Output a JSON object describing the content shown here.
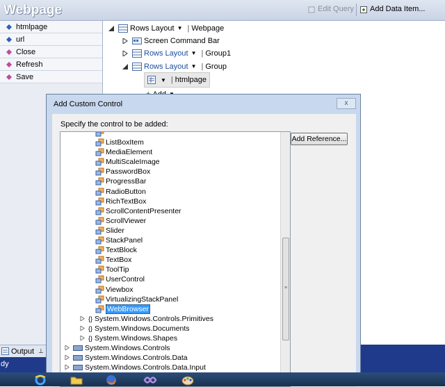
{
  "header": {
    "title": "Webpage",
    "edit_query": "Edit Query",
    "add_data_item": "Add Data Item..."
  },
  "commands": [
    "htmlpage",
    "url",
    "Close",
    "Refresh",
    "Save"
  ],
  "tree": {
    "rows_layout": "Rows Layout",
    "webpage": "Webpage",
    "screen_command_bar": "Screen Command Bar",
    "group1": "Group1",
    "group": "Group",
    "htmlpage": "htmlpage",
    "add": "Add"
  },
  "dialog": {
    "title": "Add Custom Control",
    "close": "x",
    "prompt": "Specify the control to be added:",
    "add_reference": "Add Reference...",
    "classes": [
      "ListBoxItem",
      "MediaElement",
      "MultiScaleImage",
      "PasswordBox",
      "ProgressBar",
      "RadioButton",
      "RichTextBox",
      "ScrollContentPresenter",
      "ScrollViewer",
      "Slider",
      "StackPanel",
      "TextBlock",
      "TextBox",
      "ToolTip",
      "UserControl",
      "Viewbox",
      "VirtualizingStackPanel",
      "WebBrowser"
    ],
    "namespaces": [
      "System.Windows.Controls.Primitives",
      "System.Windows.Documents",
      "System.Windows.Shapes"
    ],
    "assemblies": [
      "System.Windows.Controls",
      "System.Windows.Controls.Data",
      "System.Windows.Controls.Data.Input"
    ]
  },
  "bottom": {
    "output": "Output",
    "status": "dy"
  },
  "colors": {
    "selection": "#3399ff",
    "header": "#c9d4e6",
    "taskbar": "#18314f"
  }
}
